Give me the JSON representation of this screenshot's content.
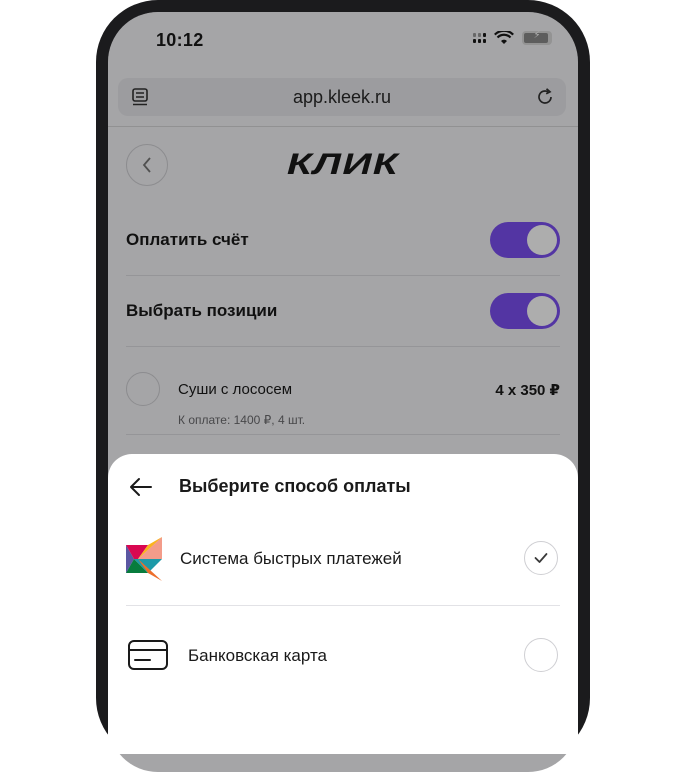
{
  "status_bar": {
    "time": "10:12",
    "battery_bolt": "⚡"
  },
  "browser": {
    "url": "app.kleek.ru"
  },
  "app": {
    "logo": "КЛИК",
    "toggles": [
      {
        "label": "Оплатить счёт",
        "on": true
      },
      {
        "label": "Выбрать позиции",
        "on": true
      }
    ],
    "items": [
      {
        "name": "Суши с лососем",
        "qty_price": "4 x 350 ₽",
        "subtitle": "К оплате: 1400 ₽, 4 шт."
      }
    ]
  },
  "payment_sheet": {
    "title": "Выберите способ оплаты",
    "options": [
      {
        "label": "Система быстрых платежей",
        "selected": true,
        "icon": "sbp-logo-icon"
      },
      {
        "label": "Банковская карта",
        "selected": false,
        "icon": "bank-card-icon"
      }
    ]
  },
  "colors": {
    "accent": "#7b4ff0",
    "phone_frame": "#1b1b1d"
  }
}
